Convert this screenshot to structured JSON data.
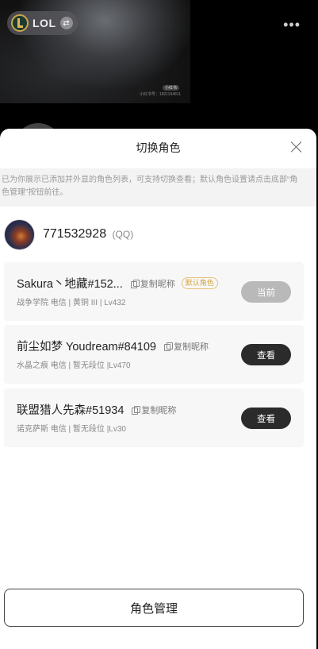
{
  "background": {
    "game_chip": {
      "label": "LOL",
      "logo_icon": "lol-logo-icon",
      "switch_icon": "switch-icon"
    },
    "more_label": "•••",
    "photo_watermark": "小红书号：1821194811",
    "photo_badge": "小红书"
  },
  "sheet": {
    "title": "切换角色",
    "close_icon": "close-icon",
    "notice": "已为你展示已添加并外显的角色列表，可支持切换查看；默认角色设置请点击底部“角色管理”按钮前往。",
    "account": {
      "id": "771532928",
      "type": "(QQ)"
    },
    "roles": [
      {
        "name": "Sakura丶地藏#152...",
        "copy_label": "复制昵称",
        "badge": "默认角色",
        "sub": "战争学院 电信 | 黄铜 III | Lv432",
        "button": "当前"
      },
      {
        "name": "前尘如梦 Youdream#84109",
        "copy_label": "复制昵称",
        "sub": "水晶之痕 电信 | 暂无段位 |Lv470",
        "button": "查看"
      },
      {
        "name": "联盟猎人先森#51934",
        "copy_label": "复制昵称",
        "sub": "诺克萨斯 电信 | 暂无段位 |Lv30",
        "button": "查看"
      }
    ],
    "manage_button": "角色管理"
  },
  "colors": {
    "accent_badge": "#d6a53a",
    "button_dark": "#2b2b2b",
    "button_disabled": "#b9b9b9"
  }
}
